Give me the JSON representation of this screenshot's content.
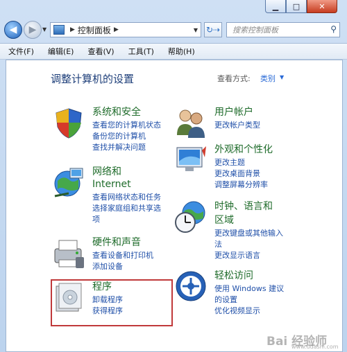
{
  "window": {
    "min_label": "▁",
    "max_label": "□",
    "close_label": "✕"
  },
  "nav": {
    "back_label": "◀",
    "forward_label": "▶",
    "address_path": "控制面板",
    "refresh_label": "↻⇢"
  },
  "search": {
    "placeholder": "搜索控制面板"
  },
  "menu": [
    "文件(F)",
    "编辑(E)",
    "查看(V)",
    "工具(T)",
    "帮助(H)"
  ],
  "heading": "调整计算机的设置",
  "view_by": {
    "label": "查看方式:",
    "value": "类别"
  },
  "categories_left": [
    {
      "title": "系统和安全",
      "title2": "",
      "links": [
        "查看您的计算机状态",
        "备份您的计算机",
        "查找并解决问题"
      ],
      "icon": "shield-flag-icon"
    },
    {
      "title": "网络和",
      "title2": "Internet",
      "links": [
        "查看网络状态和任务",
        "选择家庭组和共享选",
        "项"
      ],
      "icon": "network-globe-icon"
    },
    {
      "title": "硬件和声音",
      "title2": "",
      "links": [
        "查看设备和打印机",
        "添加设备"
      ],
      "icon": "printer-icon"
    },
    {
      "title": "程序",
      "title2": "",
      "links": [
        "卸载程序",
        "获得程序"
      ],
      "icon": "programs-icon"
    }
  ],
  "categories_right": [
    {
      "title": "用户帐户",
      "title2": "",
      "links": [
        "更改帐户类型"
      ],
      "icon": "users-icon"
    },
    {
      "title": "外观和个性化",
      "title2": "",
      "links": [
        "更改主题",
        "更改桌面背景",
        "调整屏幕分辨率"
      ],
      "icon": "monitor-icon"
    },
    {
      "title": "时钟、语言和",
      "title2": "区域",
      "links": [
        "更改键盘或其他输入",
        "法",
        "更改显示语言"
      ],
      "icon": "clock-globe-icon"
    },
    {
      "title": "轻松访问",
      "title2": "",
      "links": [
        "使用 Windows 建议",
        "的设置",
        "优化视频显示"
      ],
      "icon": "ease-of-access-icon"
    }
  ],
  "watermark": "Bai 经验师",
  "watermark_url": "www.udashi.com",
  "colors": {
    "title_green": "#1e6b2a",
    "link_blue": "#1f4fa8",
    "heading_blue": "#1e3f7a",
    "highlight_red": "#c0393a"
  }
}
